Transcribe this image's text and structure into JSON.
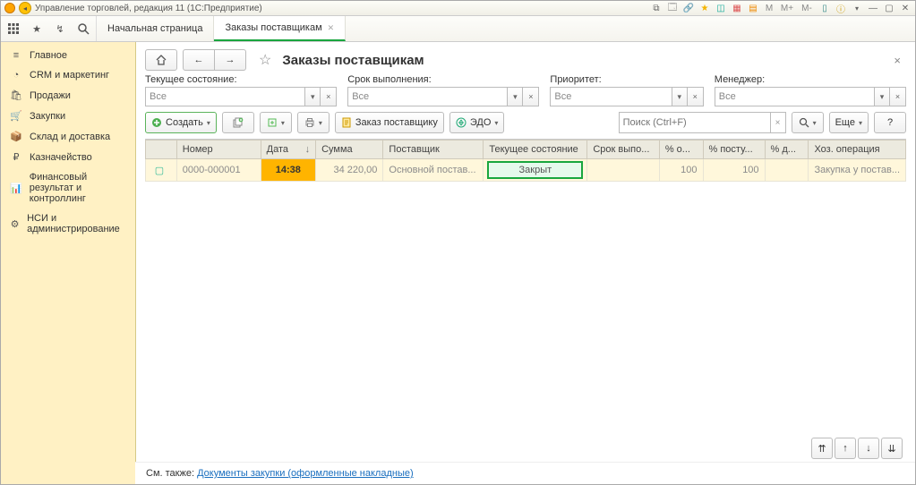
{
  "window": {
    "title": "Управление торговлей, редакция 11  (1С:Предприятие)"
  },
  "titlebar_right": {
    "m": "M",
    "mplus": "M+",
    "mminus": "M-"
  },
  "tabs": {
    "icons": [
      "apps",
      "star",
      "link",
      "search"
    ],
    "items": [
      {
        "label": "Начальная страница"
      },
      {
        "label": "Заказы поставщикам",
        "active": true
      }
    ]
  },
  "sidebar": [
    {
      "icon": "≡",
      "label": "Главное"
    },
    {
      "icon": "◔",
      "label": "CRM и маркетинг"
    },
    {
      "icon": "🛍",
      "label": "Продажи"
    },
    {
      "icon": "🛒",
      "label": "Закупки"
    },
    {
      "icon": "📦",
      "label": "Склад и доставка"
    },
    {
      "icon": "₽",
      "label": "Казначейство"
    },
    {
      "icon": "📊",
      "label": "Финансовый результат и контроллинг"
    },
    {
      "icon": "⚙",
      "label": "НСИ и администрирование"
    }
  ],
  "page": {
    "title": "Заказы поставщикам",
    "star": "☆"
  },
  "filters": {
    "state": {
      "label": "Текущее состояние:",
      "value": "Все"
    },
    "deadline": {
      "label": "Срок выполнения:",
      "value": "Все"
    },
    "priority": {
      "label": "Приоритет:",
      "value": "Все"
    },
    "manager": {
      "label": "Менеджер:",
      "value": "Все"
    }
  },
  "toolbar": {
    "create": "Создать",
    "order": "Заказ поставщику",
    "edo": "ЭДО",
    "search_placeholder": "Поиск (Ctrl+F)",
    "more": "Еще",
    "help": "?"
  },
  "table": {
    "headers": [
      "",
      "Номер",
      "Дата",
      "Сумма",
      "Поставщик",
      "Текущее состояние",
      "Срок выпо...",
      "% о...",
      "% посту...",
      "% д...",
      "Хоз. операция"
    ],
    "sort_col": "Дата",
    "rows": [
      {
        "num": "0000-000001",
        "date": "14:38",
        "sum": "34 220,00",
        "supplier": "Основной постав...",
        "state": "Закрыт",
        "deadline": "",
        "pct_o": "100",
        "pct_in": "100",
        "pct_d": "",
        "op": "Закупка у постав..."
      }
    ]
  },
  "footer_nav": [
    "⇈",
    "↑",
    "↓",
    "⇊"
  ],
  "seealso": {
    "prefix": "См. также: ",
    "link": "Документы закупки (оформленные накладные)"
  }
}
